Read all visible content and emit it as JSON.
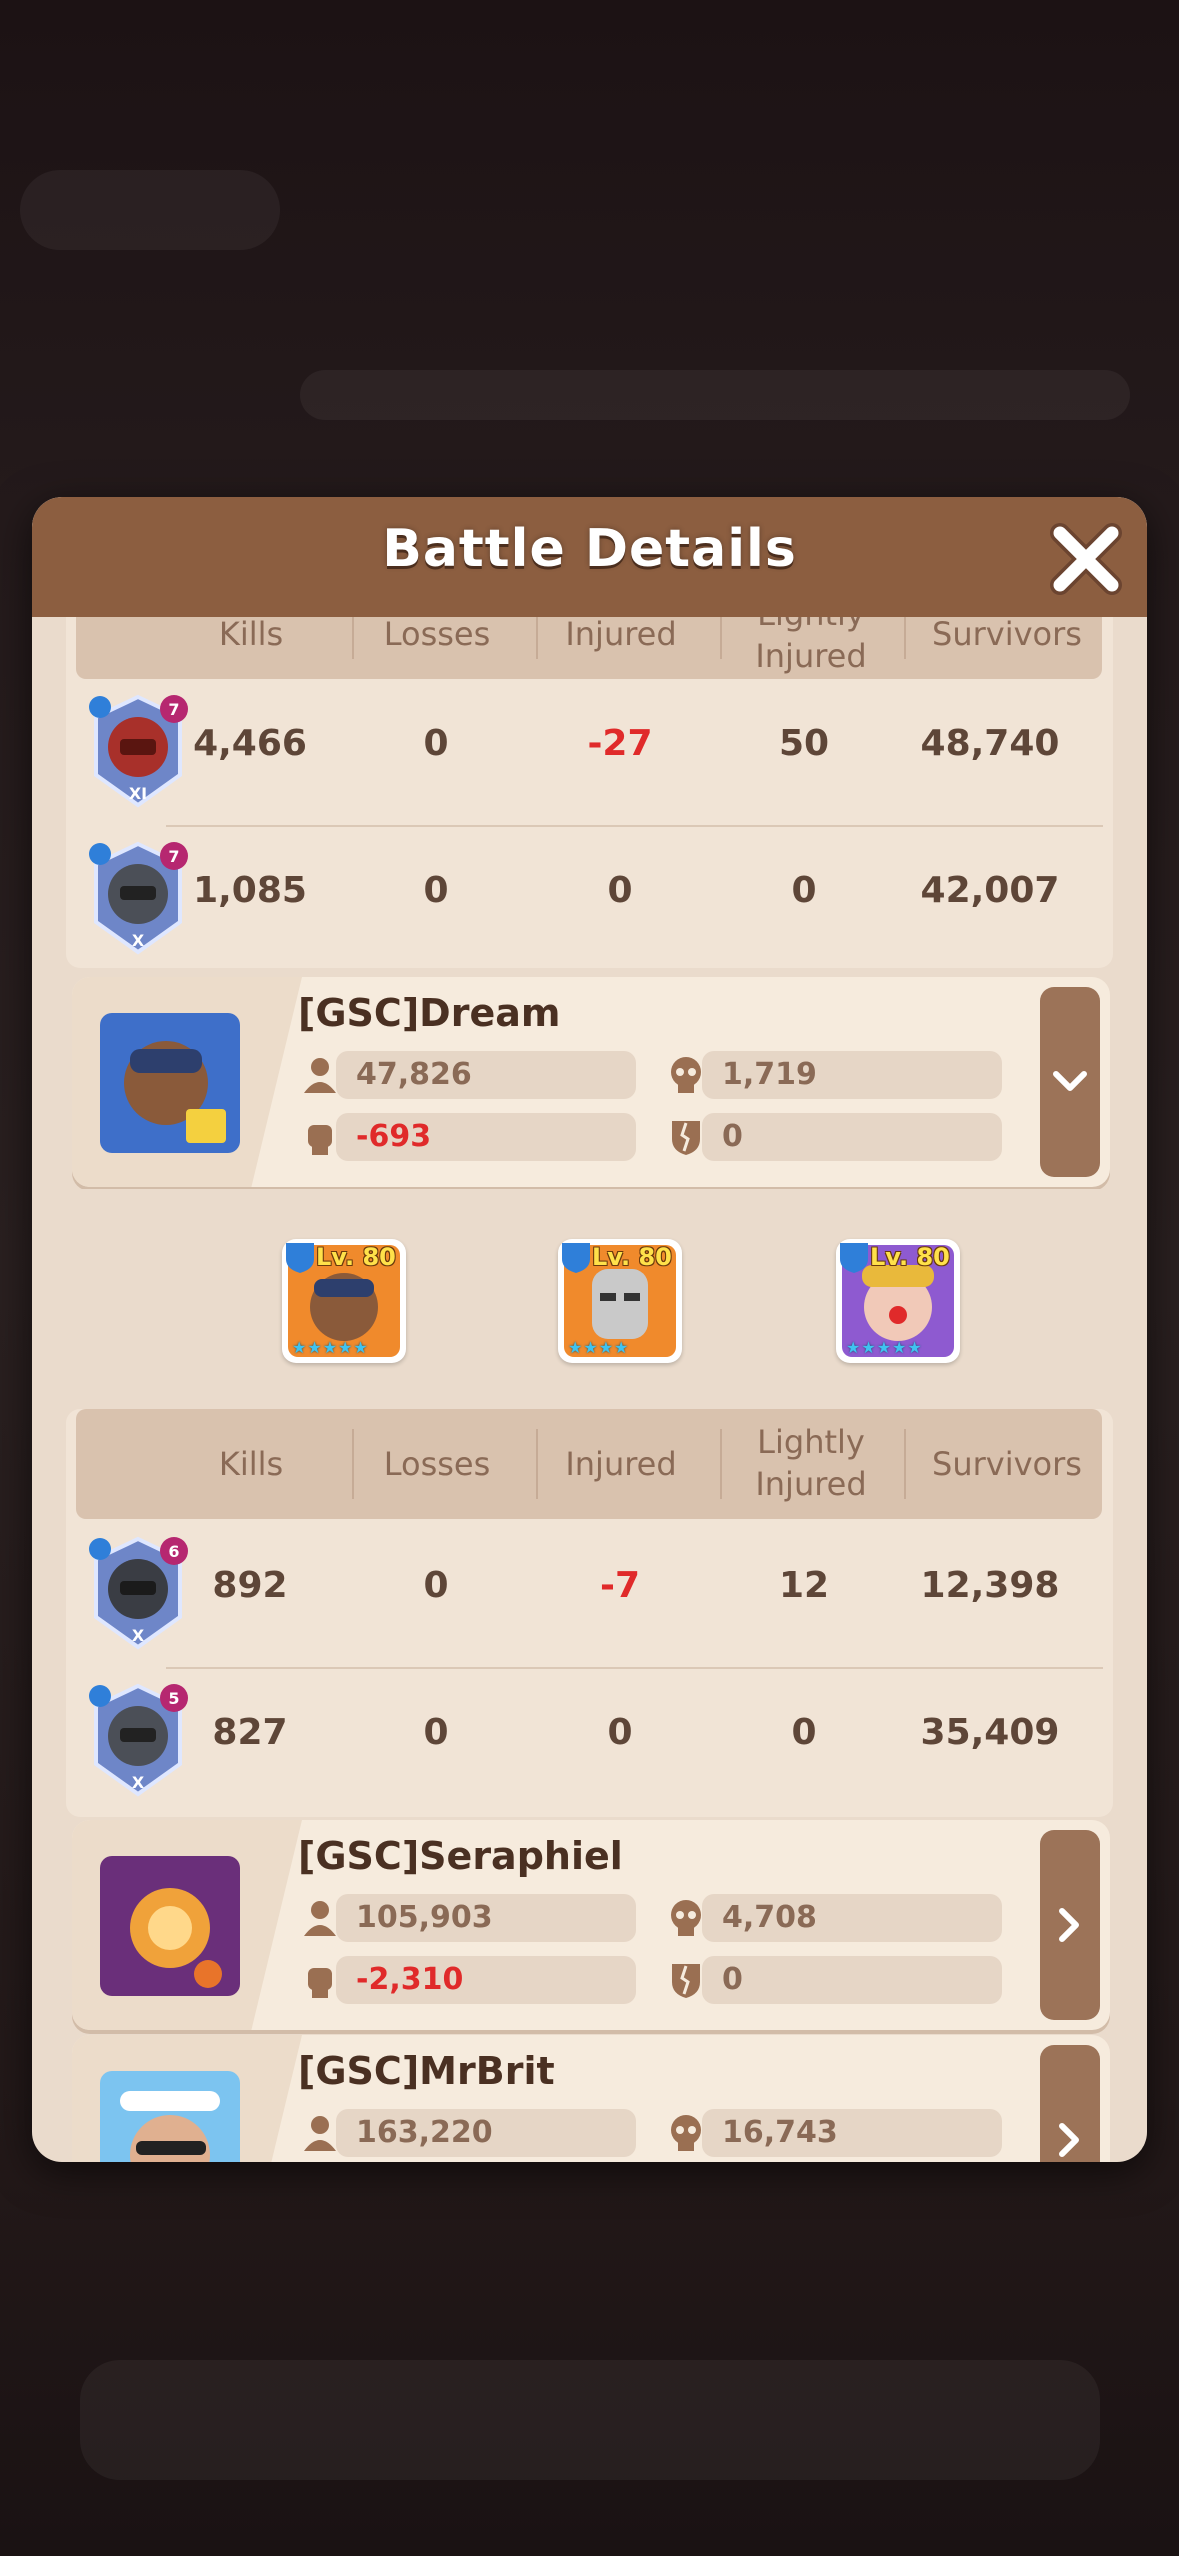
{
  "dialog": {
    "title": "Battle Details"
  },
  "columns": [
    "Kills",
    "Losses",
    "Injured",
    "Lightly Injured",
    "Survivors"
  ],
  "block1": {
    "rows": [
      {
        "level": "7",
        "rank": "XI",
        "kills": "4,466",
        "losses": "0",
        "injured": "-27",
        "lightly": "50",
        "survivors": "48,740"
      },
      {
        "level": "7",
        "rank": "X",
        "kills": "1,085",
        "losses": "0",
        "injured": "0",
        "lightly": "0",
        "survivors": "42,007"
      }
    ]
  },
  "players": [
    {
      "name": "[GSC]Dream",
      "troops": "47,826",
      "kills": "1,719",
      "losses": "-693",
      "injured": "0",
      "expanded": true
    },
    {
      "name": "[GSC]Seraphiel",
      "troops": "105,903",
      "kills": "4,708",
      "losses": "-2,310",
      "injured": "0",
      "expanded": false
    },
    {
      "name": "[GSC]MrBrit",
      "troops": "163,220",
      "kills": "16,743",
      "expanded": false
    }
  ],
  "heroes": [
    {
      "level": "Lv. 80",
      "stars": "★★★★★"
    },
    {
      "level": "Lv. 80",
      "stars": "★★★★"
    },
    {
      "level": "Lv. 80",
      "stars": "★★★★★"
    }
  ],
  "block2": {
    "rows": [
      {
        "level": "6",
        "rank": "X",
        "kills": "892",
        "losses": "0",
        "injured": "-7",
        "lightly": "12",
        "survivors": "12,398"
      },
      {
        "level": "5",
        "rank": "X",
        "kills": "827",
        "losses": "0",
        "injured": "0",
        "lightly": "0",
        "survivors": "35,409"
      }
    ]
  },
  "colors": {
    "negative": "#e02a2a",
    "header": "#8c5e40",
    "panel": "#eadbcc"
  }
}
